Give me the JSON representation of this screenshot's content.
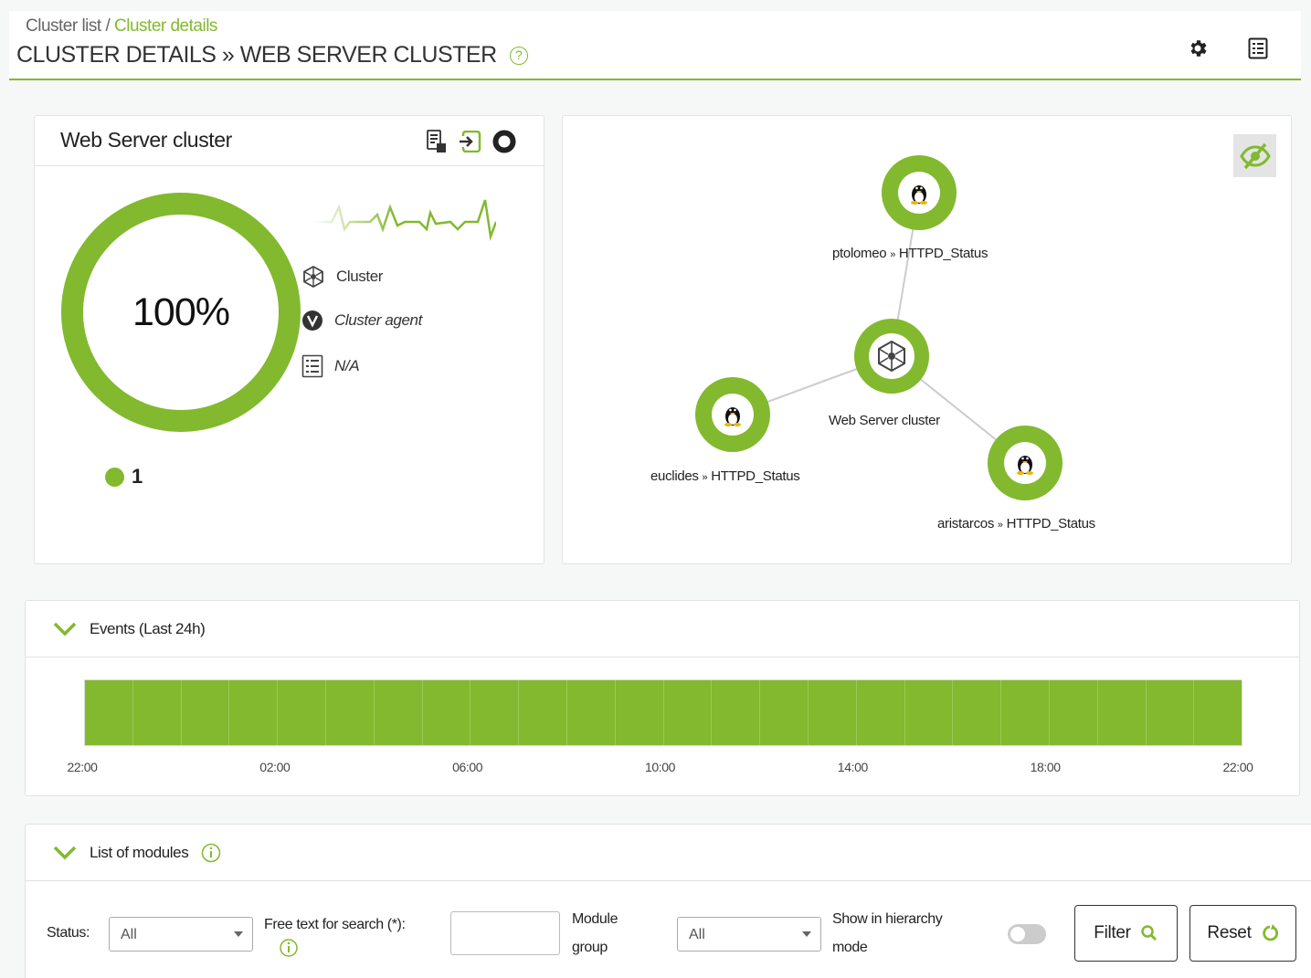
{
  "breadcrumb": {
    "parent": "Cluster list",
    "separator": " / ",
    "current": "Cluster details"
  },
  "page_title": "CLUSTER DETAILS » WEB SERVER CLUSTER",
  "help_glyph": "?",
  "header_icons": [
    "gear-icon",
    "list-view-icon"
  ],
  "cluster_card": {
    "title": "Web Server cluster",
    "status_percent": "100%",
    "status_percent_value": 100,
    "legend_count": "1",
    "head_icons": [
      "server-report-icon",
      "login-icon",
      "status-ring-icon"
    ],
    "info": [
      {
        "icon": "cluster-icon",
        "text": "Cluster"
      },
      {
        "icon": "agent-v-icon",
        "text": "Cluster agent"
      },
      {
        "icon": "list-icon",
        "text": "N/A"
      }
    ]
  },
  "cluster_map": {
    "nodes": [
      {
        "label_agent": "ptolomeo",
        "label_module": "HTTPD_Status",
        "icon": "linux-tux-icon"
      },
      {
        "label": "Web Server cluster",
        "icon": "cluster-icon"
      },
      {
        "label_agent": "euclides",
        "label_module": "HTTPD_Status",
        "icon": "linux-tux-icon"
      },
      {
        "label_agent": "aristarcos",
        "label_module": "HTTPD_Status",
        "icon": "linux-tux-icon"
      }
    ],
    "separator": "»",
    "hide_button_icon": "eye-slash-icon"
  },
  "events": {
    "title": "Events (Last 24h)",
    "segments": 24,
    "ticks": [
      "22:00",
      "02:00",
      "06:00",
      "10:00",
      "14:00",
      "18:00",
      "22:00"
    ]
  },
  "modules": {
    "title": "List of modules",
    "status_label": "Status:",
    "status_value": "All",
    "free_text_label": "Free text for search (*):",
    "free_text_value": "",
    "module_group_label_1": "Module",
    "module_group_label_2": "group",
    "module_group_value": "All",
    "hierarchy_label_1": "Show in hierarchy",
    "hierarchy_label_2": "mode",
    "hierarchy_enabled": false,
    "filter_button": "Filter",
    "reset_button": "Reset"
  },
  "colors": {
    "accent": "#82b92e",
    "text": "#333333",
    "border": "#e2e2e2"
  }
}
